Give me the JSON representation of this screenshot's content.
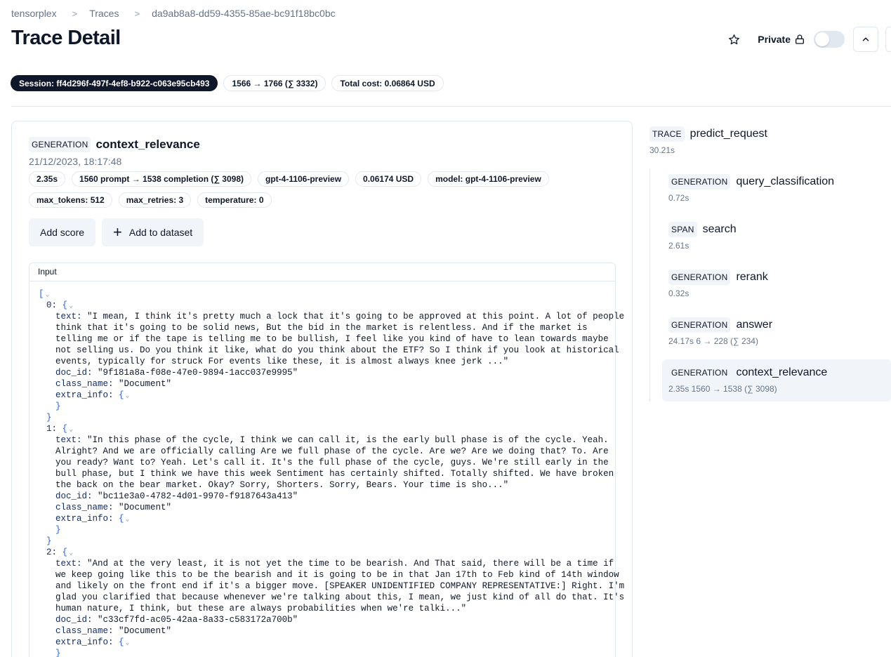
{
  "breadcrumb": {
    "items": [
      "tensorplex",
      "Traces",
      "da9ab8a8-dd59-4355-85ae-bc91f18bc0bc"
    ],
    "separator": ">"
  },
  "page_title": "Trace Detail",
  "header": {
    "private_label": "Private",
    "star_icon": "star-icon",
    "lock_icon": "lock-icon",
    "toggle_on": false,
    "collapse_icon": "chevron-up-icon"
  },
  "trace_badges": {
    "session": "Session: ff4d296f-497f-4ef8-b922-c063e95cb493",
    "tokens": "1566 → 1766 (∑ 3332)",
    "cost": "Total cost: 0.06864 USD"
  },
  "observation": {
    "type": "GENERATION",
    "name": "context_relevance",
    "timestamp": "21/12/2023, 18:17:48",
    "badges_row1": [
      "2.35s",
      "1560 prompt → 1538 completion (∑ 3098)",
      "gpt-4-1106-preview",
      "0.06174 USD",
      "model: gpt-4-1106-preview"
    ],
    "badges_row2": [
      "max_tokens: 512",
      "max_retries: 3",
      "temperature: 0"
    ],
    "add_score_label": "Add score",
    "add_dataset_label": "Add to dataset",
    "input_label": "Input"
  },
  "json_view": {
    "open_bracket": "[",
    "close_bracket": "}",
    "items": [
      {
        "index": "0:",
        "text_lines": [
          "\"I mean, I think it's pretty much a lock that it's going to be approved at this point. A lot of people",
          "think that it's going to be solid news, But the bid in the market is relentless. And if the market is",
          "telling me or if the tape is telling me to be bullish, I feel like you kind of have to lean towards maybe",
          "not selling us. Do you think it like, what do you think about the ETF? So I think if you look at historical",
          "events, typically for struck For events like these, it is almost always knee jerk ...\""
        ],
        "doc_id": "\"9f181a8a-f08e-47e0-9894-1acc037e9995\"",
        "class_name": "\"Document\""
      },
      {
        "index": "1:",
        "text_lines": [
          "\"In this phase of the cycle, I think we can call it, is the early bull phase is of the cycle. Yeah.",
          "Alright? And we are officially calling Are we full phase of the cycle. Are we? Are we doing that? To. Are",
          "you ready? Want to? Yeah. Let's call it. It's the full phase of the cycle, guys. We're still early in the",
          "bull phase, but I think we have this week Sentiment has certainly shifted. Totally shifted. We have broken",
          "the back on the bear market. Okay? Sorry, Shorters. Sorry, Bears. Your time is sho...\""
        ],
        "doc_id": "\"bc11e3a0-4782-4d01-9970-f9187643a413\"",
        "class_name": "\"Document\""
      },
      {
        "index": "2:",
        "text_lines": [
          "\"And at the very least, it is not yet the time to be bearish. And That said, there will be a time if",
          "we keep going like this to be the bearish and it is going to be in that Jan 17th to Feb kind of 14th window",
          "and likely on the front end if it's a bigger move. [SPEAKER UNIDENTIFIED COMPANY REPRESENTATIVE:] Right. I'm",
          "glad you clarified that because whenever we're talking about this, I mean, we just kind of all do that. It's",
          "human nature, I think, but these are always probabilities when we're talki...\""
        ],
        "doc_id": "\"c33cf7fd-ac05-42aa-8a33-c583172a700b\"",
        "class_name": "\"Document\""
      }
    ],
    "keys": {
      "text": "text:",
      "doc_id": "doc_id:",
      "class_name": "class_name:",
      "extra_info": "extra_info:"
    }
  },
  "trace_tree": {
    "root": {
      "type": "TRACE",
      "name": "predict_request",
      "meta": "30.21s"
    },
    "children": [
      {
        "type": "GENERATION",
        "name": "query_classification",
        "meta": "0.72s",
        "selected": false
      },
      {
        "type": "SPAN",
        "name": "search",
        "meta": "2.61s",
        "selected": false
      },
      {
        "type": "GENERATION",
        "name": "rerank",
        "meta": "0.32s",
        "selected": false
      },
      {
        "type": "GENERATION",
        "name": "answer",
        "meta": "24.17s   6 → 228 (∑ 234)",
        "selected": false
      },
      {
        "type": "GENERATION",
        "name": "context_relevance",
        "meta": "2.35s   1560 → 1538 (∑ 3098)",
        "selected": true
      }
    ]
  }
}
